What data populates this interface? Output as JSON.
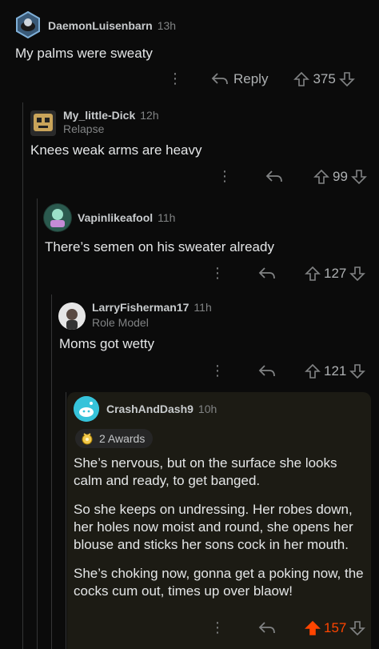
{
  "comments": [
    {
      "username": "DaemonLuisenbarn",
      "age": "13h",
      "body": "My palms were sweaty",
      "reply_label": "Reply",
      "score": "375"
    },
    {
      "username": "My_little-Dick",
      "age": "12h",
      "flair": "Relapse",
      "body": "Knees weak arms are heavy",
      "score": "99"
    },
    {
      "username": "Vapinlikeafool",
      "age": "11h",
      "body": "There’s semen on his sweater already",
      "score": "127"
    },
    {
      "username": "LarryFisherman17",
      "age": "11h",
      "flair": "Role Model",
      "body": "Moms got wetty",
      "score": "121"
    },
    {
      "username": "CrashAndDash9",
      "age": "10h",
      "awards": "2 Awards",
      "paragraphs": [
        "She’s nervous, but on the surface she looks calm and ready, to get banged.",
        "So she keeps on undressing. Her robes down, her holes now moist and round, she opens her blouse and sticks her sons cock in her mouth.",
        "She’s choking now, gonna get a poking now, the cocks cum out, times up over blaow!"
      ],
      "score": "157"
    }
  ],
  "colors": {
    "background": "#0b0b0b",
    "upvoted": "#ff4500",
    "highlight": "#1c1b14",
    "thread_line": "#343536"
  }
}
